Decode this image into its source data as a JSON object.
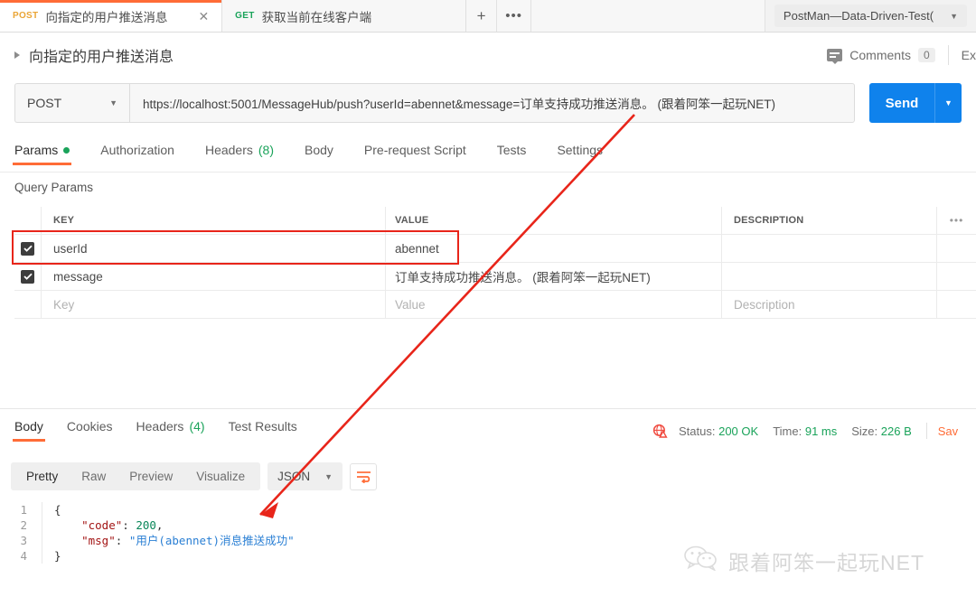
{
  "window": {
    "workspace_selector": "PostMan—Data-Driven-Test(",
    "caret": "▼"
  },
  "tabbar": {
    "tabs": [
      {
        "method": "POST",
        "label": "向指定的用户推送消息",
        "close": "✕",
        "active": true
      },
      {
        "method": "GET",
        "label": "获取当前在线客户端",
        "close": "",
        "active": false
      }
    ],
    "new_tab": "+",
    "more": "•••"
  },
  "titlerow": {
    "expand_arrow": "▶",
    "request_name": "向指定的用户推送消息",
    "comments_label": "Comments",
    "comments_count": "0",
    "examples_label": "Ex"
  },
  "url_row": {
    "method": "POST",
    "method_caret": "▼",
    "url": "https://localhost:5001/MessageHub/push?userId=abennet&message=订单支持成功推送消息。 (跟着阿笨一起玩NET)",
    "send_label": "Send",
    "send_caret": "▼"
  },
  "request_tabs": [
    {
      "label": "Params",
      "badge": "",
      "dot": true,
      "active": true
    },
    {
      "label": "Authorization",
      "badge": "",
      "dot": false,
      "active": false
    },
    {
      "label": "Headers",
      "badge": "(8)",
      "dot": false,
      "active": false
    },
    {
      "label": "Body",
      "badge": "",
      "dot": false,
      "active": false
    },
    {
      "label": "Pre-request Script",
      "badge": "",
      "dot": false,
      "active": false
    },
    {
      "label": "Tests",
      "badge": "",
      "dot": false,
      "active": false
    },
    {
      "label": "Settings",
      "badge": "",
      "dot": false,
      "active": false
    }
  ],
  "query_params": {
    "section_label": "Query Params",
    "headers": {
      "key": "KEY",
      "value": "VALUE",
      "description": "DESCRIPTION",
      "bulk": "•••"
    },
    "rows": [
      {
        "checked": true,
        "key": "userId",
        "value": "abennet",
        "description": "",
        "highlighted": true
      },
      {
        "checked": true,
        "key": "message",
        "value": "订单支持成功推送消息。 (跟着阿笨一起玩NET)",
        "description": "",
        "highlighted": false
      },
      {
        "checked": false,
        "key": "Key",
        "value": "Value",
        "description": "Description",
        "placeholder": true,
        "highlighted": false
      }
    ]
  },
  "response": {
    "tabs": [
      {
        "label": "Body",
        "badge": "",
        "active": true
      },
      {
        "label": "Cookies",
        "badge": "",
        "active": false
      },
      {
        "label": "Headers",
        "badge": "(4)",
        "active": false
      },
      {
        "label": "Test Results",
        "badge": "",
        "active": false
      }
    ],
    "status_label": "Status:",
    "status_value": "200 OK",
    "time_label": "Time:",
    "time_value": "91 ms",
    "size_label": "Size:",
    "size_value": "226 B",
    "save_label": "Sav",
    "toolbar": {
      "views": [
        "Pretty",
        "Raw",
        "Preview",
        "Visualize"
      ],
      "active_view": "Pretty",
      "format": "JSON",
      "format_caret": "▼"
    },
    "body_lines": [
      {
        "num": "1",
        "tokens": [
          {
            "t": "{",
            "c": "tk-brace"
          }
        ]
      },
      {
        "num": "2",
        "tokens": [
          {
            "t": "    ",
            "c": "tk-punc"
          },
          {
            "t": "\"code\"",
            "c": "tk-key"
          },
          {
            "t": ": ",
            "c": "tk-punc"
          },
          {
            "t": "200",
            "c": "tk-num"
          },
          {
            "t": ",",
            "c": "tk-punc"
          }
        ]
      },
      {
        "num": "3",
        "tokens": [
          {
            "t": "    ",
            "c": "tk-punc"
          },
          {
            "t": "\"msg\"",
            "c": "tk-key"
          },
          {
            "t": ": ",
            "c": "tk-punc"
          },
          {
            "t": "\"用户(abennet)消息推送成功\"",
            "c": "tk-str"
          }
        ]
      },
      {
        "num": "4",
        "tokens": [
          {
            "t": "}",
            "c": "tk-brace"
          }
        ]
      }
    ]
  },
  "watermark": {
    "text": "跟着阿笨一起玩NET"
  },
  "colors": {
    "accent_orange": "#ff6c37",
    "send_blue": "#0f82ec",
    "success_green": "#1aa35a",
    "annotation_red": "#e8251a",
    "post_amber": "#eaa536"
  }
}
